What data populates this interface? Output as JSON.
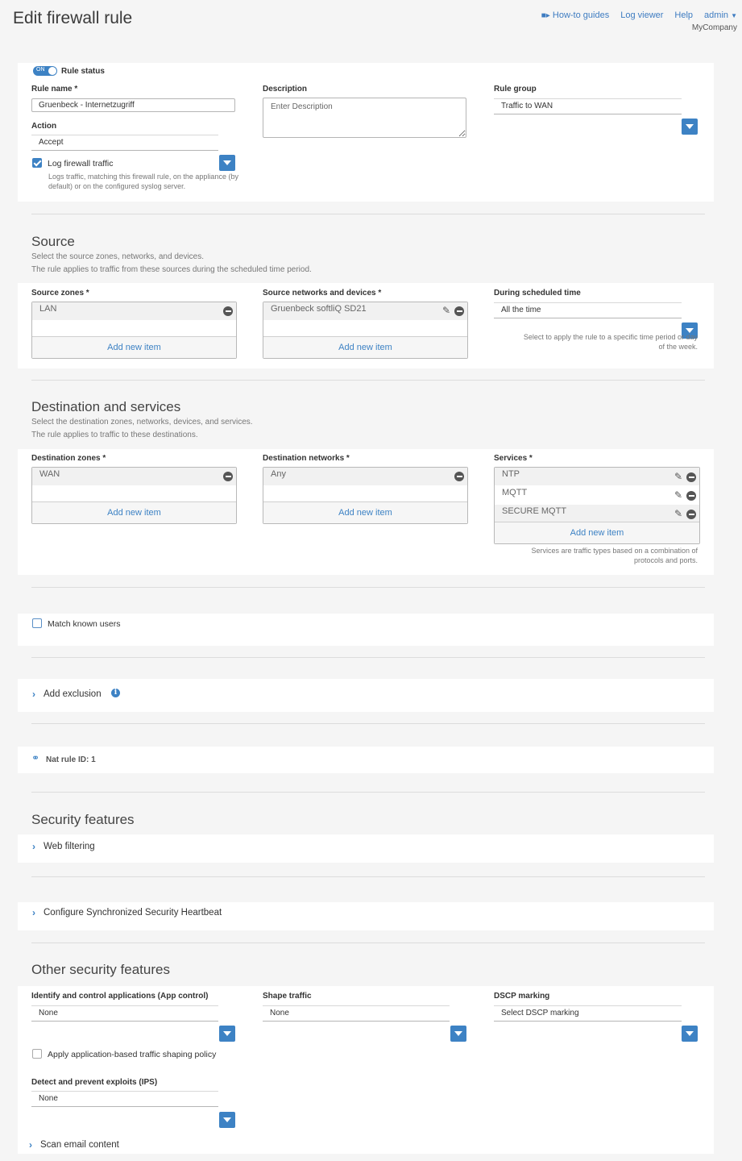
{
  "header": {
    "title": "Edit firewall rule",
    "links": [
      "How-to guides",
      "Log viewer",
      "Help"
    ],
    "user": "admin",
    "company": "MyCompany"
  },
  "rule": {
    "status_label": "Rule status",
    "toggle_text": "ON",
    "name_label": "Rule name *",
    "name_value": "Gruenbeck - Internetzugriff",
    "action_label": "Action",
    "action_value": "Accept",
    "log_label": "Log firewall traffic",
    "log_help": "Logs traffic, matching this firewall rule, on the appliance (by default) or on the configured syslog server.",
    "description_label": "Description",
    "description_placeholder": "Enter Description",
    "group_label": "Rule group",
    "group_value": "Traffic to WAN"
  },
  "source": {
    "title": "Source",
    "desc1": "Select the source zones, networks, and devices.",
    "desc2": "The rule applies to traffic from these sources during the scheduled time period.",
    "zones_label": "Source zones *",
    "zones": [
      "LAN"
    ],
    "networks_label": "Source networks and devices *",
    "networks": [
      "Gruenbeck softliQ SD21"
    ],
    "schedule_label": "During scheduled time",
    "schedule_value": "All the time",
    "schedule_help": "Select to apply the rule to a specific time period or day of the week.",
    "add_new": "Add new item"
  },
  "destination": {
    "title": "Destination and services",
    "desc1": "Select the destination zones, networks, devices, and services.",
    "desc2": "The rule applies to traffic to these destinations.",
    "zones_label": "Destination zones *",
    "zones": [
      "WAN"
    ],
    "networks_label": "Destination networks *",
    "networks": [
      "Any"
    ],
    "services_label": "Services *",
    "services": [
      "NTP",
      "MQTT",
      "SECURE MQTT"
    ],
    "services_help": "Services are traffic types based on a combination of protocols and ports.",
    "add_new": "Add new item"
  },
  "users": {
    "match_label": "Match known users"
  },
  "exclusion": {
    "label": "Add exclusion"
  },
  "nat": {
    "label": "Nat rule ID: 1"
  },
  "security": {
    "title": "Security features",
    "web_filtering": "Web filtering",
    "heartbeat": "Configure Synchronized Security Heartbeat"
  },
  "other": {
    "title": "Other security features",
    "app_label": "Identify and control applications (App control)",
    "app_value": "None",
    "shape_label": "Shape traffic",
    "shape_value": "None",
    "dscp_label": "DSCP marking",
    "dscp_value": "Select DSCP marking",
    "app_shaping_label": "Apply application-based traffic shaping policy",
    "ips_label": "Detect and prevent exploits (IPS)",
    "ips_value": "None",
    "scan_email": "Scan email content"
  },
  "colors": {
    "accent": "#3d82c4",
    "background": "#f5f5f5"
  }
}
